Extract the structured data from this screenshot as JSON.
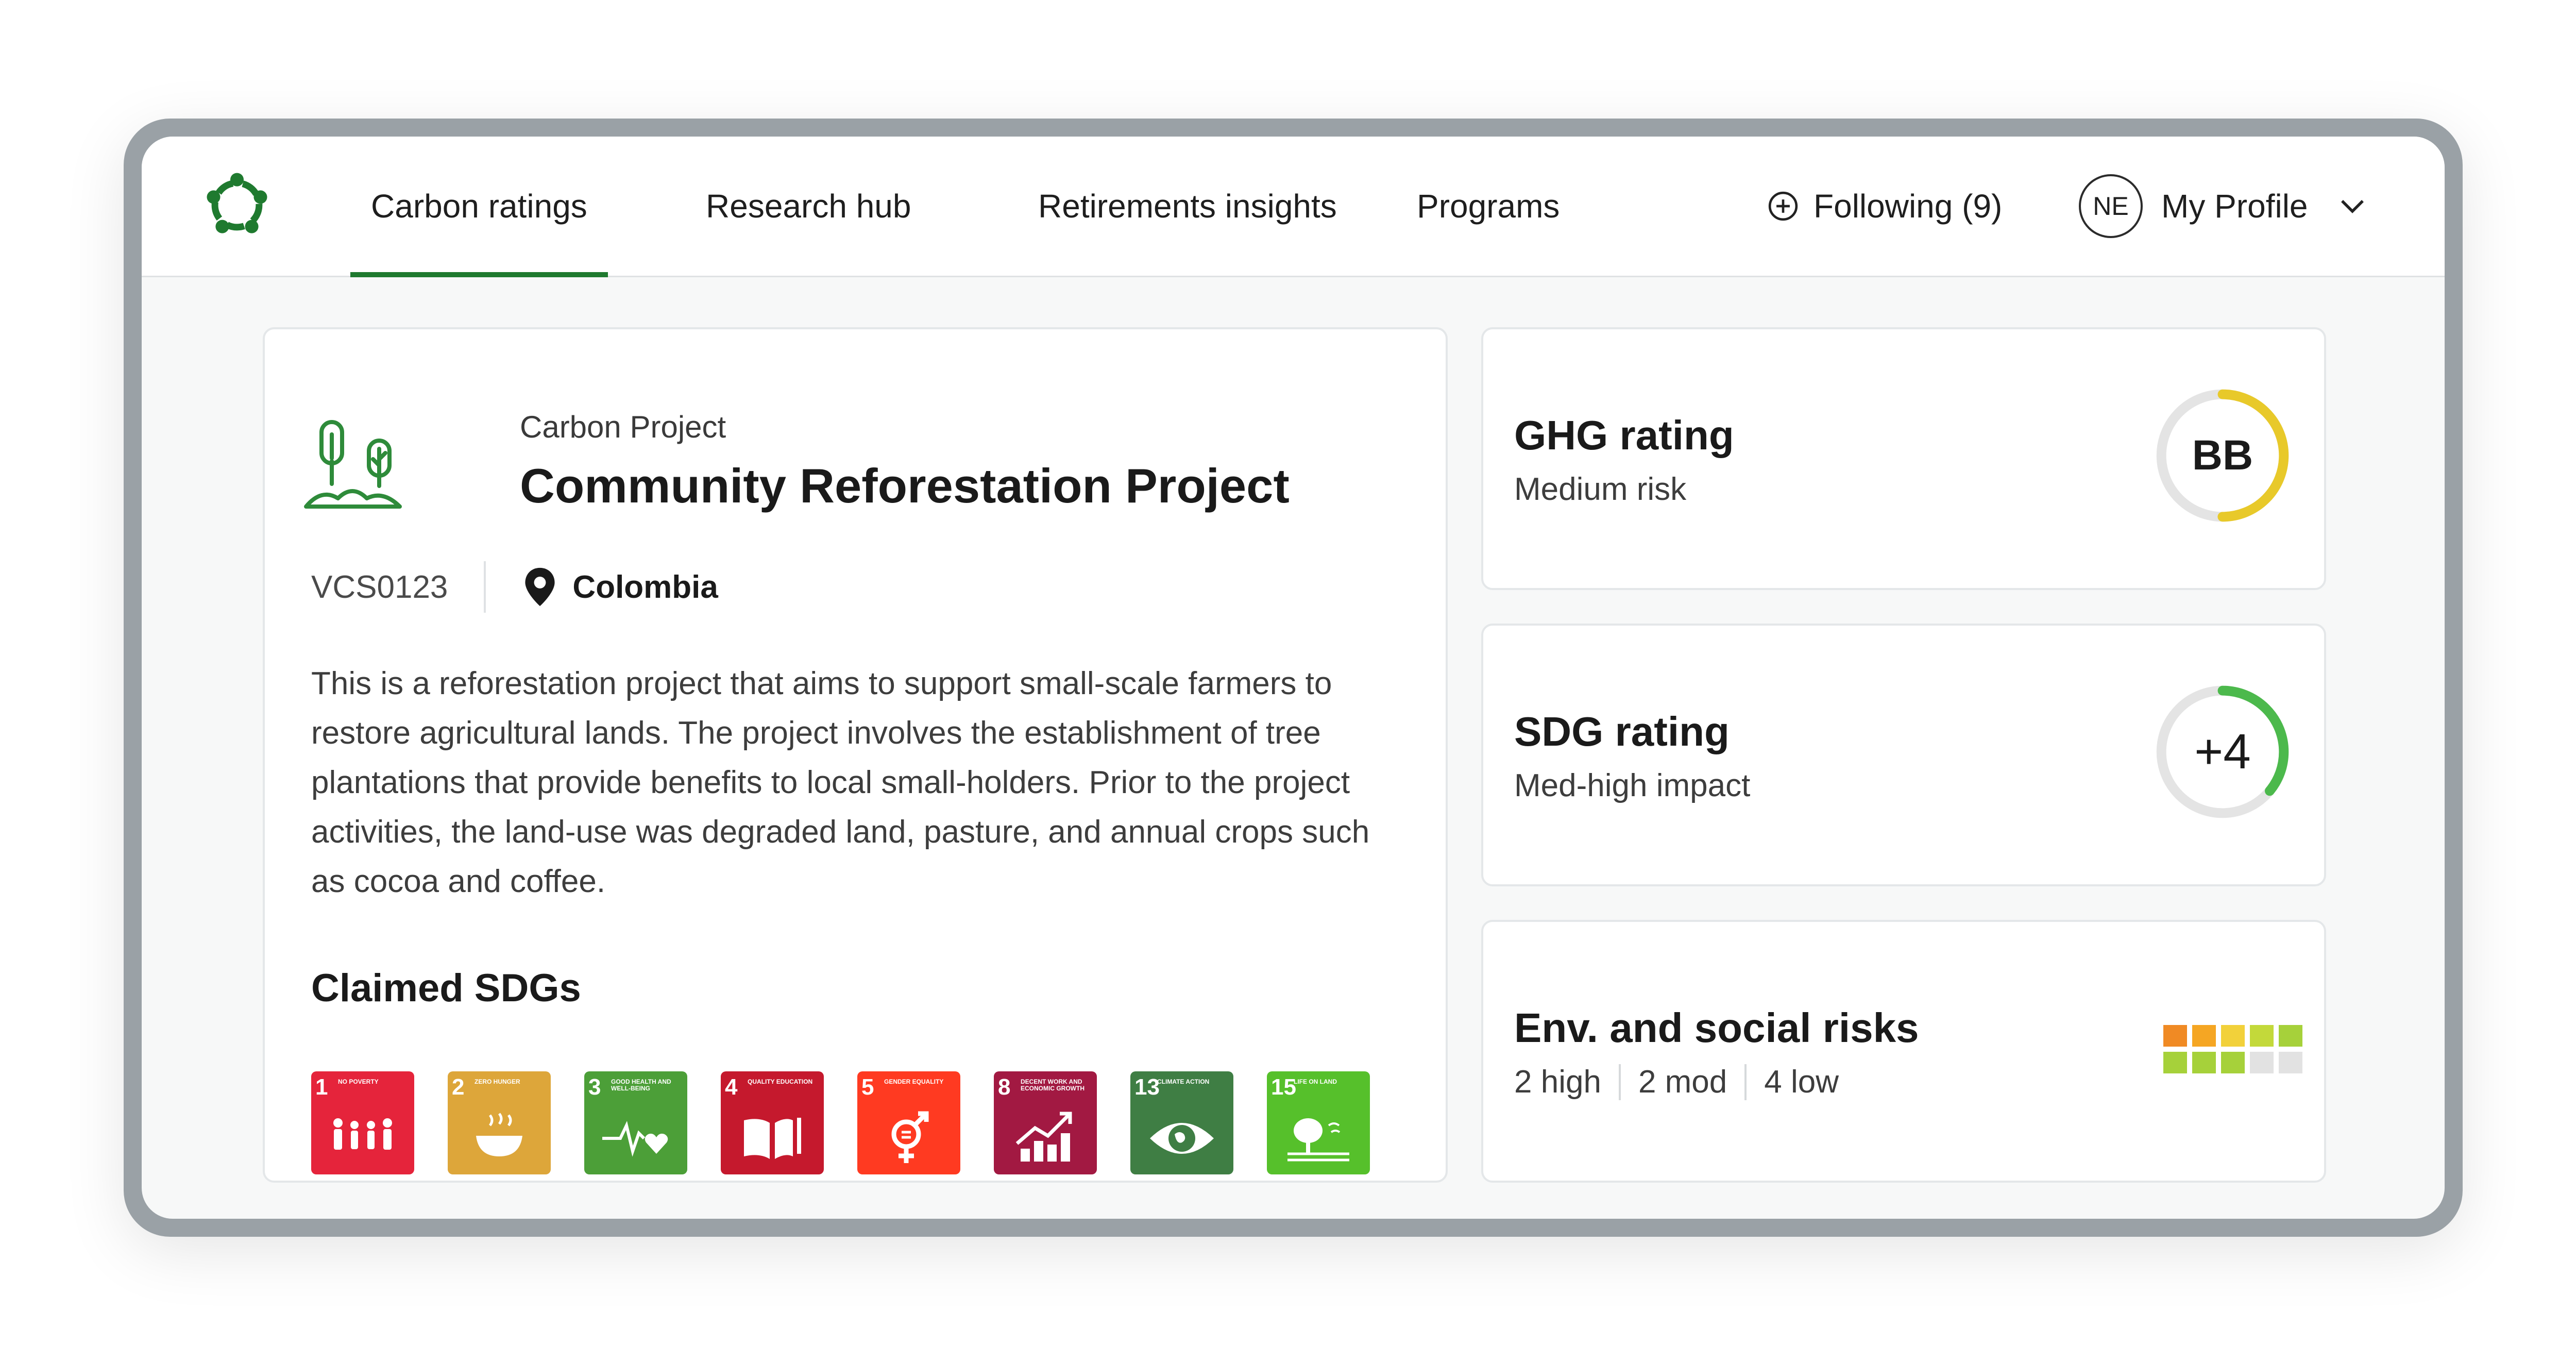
{
  "nav": {
    "items": [
      {
        "label": "Carbon ratings",
        "active": true
      },
      {
        "label": "Research hub",
        "active": false
      },
      {
        "label": "Retirements insights",
        "active": false
      },
      {
        "label": "Programs",
        "active": false
      }
    ],
    "following_label": "Following (9)",
    "profile_initials": "NE",
    "profile_label": "My Profile",
    "accent_color": "#1f7a2f"
  },
  "project": {
    "eyebrow": "Carbon Project",
    "title": "Community Reforestation Project",
    "code": "VCS0123",
    "country": "Colombia",
    "description": "This is a reforestation project that aims to support small-scale farmers to restore agricultural lands. The project involves the establishment of tree plantations that provide benefits to local small-holders. Prior to the project activities, the land-use was degraded land, pasture, and annual crops such as cocoa and coffee.",
    "sdg_heading": "Claimed SDGs",
    "sdgs": [
      {
        "num": "1",
        "label": "No poverty",
        "color": "#e5243b",
        "icon": "people-icon"
      },
      {
        "num": "2",
        "label": "Zero hunger",
        "color": "#dda63a",
        "icon": "bowl-icon"
      },
      {
        "num": "3",
        "label": "Good health and well-being",
        "color": "#4c9f38",
        "icon": "heartbeat-icon"
      },
      {
        "num": "4",
        "label": "Quality education",
        "color": "#c5192d",
        "icon": "book-icon"
      },
      {
        "num": "5",
        "label": "Gender equality",
        "color": "#ff3a21",
        "icon": "gender-icon"
      },
      {
        "num": "8",
        "label": "Decent work and economic growth",
        "color": "#a21942",
        "icon": "growth-chart-icon"
      },
      {
        "num": "13",
        "label": "Climate action",
        "color": "#3f7e44",
        "icon": "eye-globe-icon"
      },
      {
        "num": "15",
        "label": "Life on land",
        "color": "#56c02b",
        "icon": "tree-icon"
      }
    ]
  },
  "ghg": {
    "title": "GHG rating",
    "subtitle": "Medium risk",
    "value": "BB",
    "ring_fraction": 0.5,
    "ring_color": "#e8c92a"
  },
  "sdg_rating": {
    "title": "SDG rating",
    "subtitle": "Med-high impact",
    "value": "+4",
    "ring_fraction": 0.36,
    "ring_color": "#4cb94c"
  },
  "risks": {
    "title": "Env. and social risks",
    "high": "2 high",
    "mod": "2 mod",
    "low": "4 low",
    "grid_colors": [
      "#f08a24",
      "#f5a623",
      "#f2d13a",
      "#c3d93a",
      "#a6d13a",
      "#a6d13a",
      "#a6d13a",
      "#a6d13a",
      "#e2e2e2",
      "#e2e2e2"
    ]
  }
}
